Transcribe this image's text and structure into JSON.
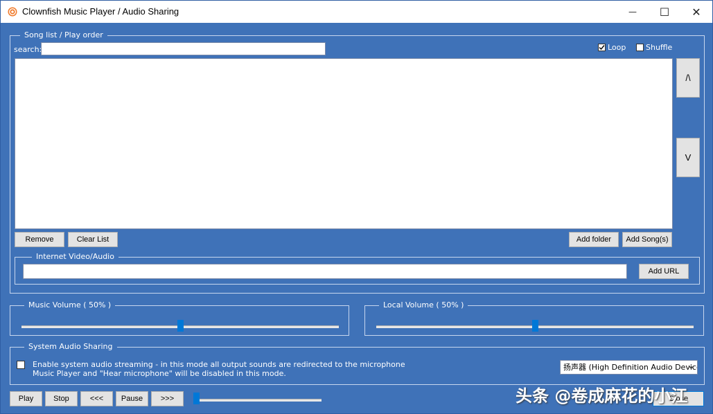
{
  "window": {
    "title": "Clownfish Music Player / Audio Sharing",
    "minimize_glyph": "—",
    "maximize_glyph": "☐",
    "close_glyph": "✕"
  },
  "song_group": {
    "legend": "Song list / Play order",
    "search_label": "search:",
    "search_value": "",
    "loop_label": "Loop",
    "loop_checked": true,
    "shuffle_label": "Shuffle",
    "shuffle_checked": false,
    "up_label": "/\\",
    "down_label": "V",
    "remove_label": "Remove",
    "clear_label": "Clear List",
    "add_folder_label": "Add folder",
    "add_songs_label": "Add Song(s)"
  },
  "internet_group": {
    "legend": "Internet Video/Audio",
    "url_value": "",
    "add_url_label": "Add URL"
  },
  "music_volume": {
    "legend": "Music Volume ( 50% )",
    "level": 0.5
  },
  "local_volume": {
    "legend": "Local Volume ( 50% )",
    "level": 0.5
  },
  "sharing_group": {
    "legend": "System Audio Sharing",
    "enable_checked": false,
    "line1": "Enable system audio streaming - in this mode all output sounds are redirected to the microphone",
    "line2": "Music Player and \"Hear microphone\" will be disabled  in this mode.",
    "device_selected": "扬声器 (High Definition Audio Device"
  },
  "transport": {
    "play": "Play",
    "stop": "Stop",
    "prev": "<<<",
    "pause": "Pause",
    "next": ">>>",
    "position": 0.0,
    "close": "Close"
  },
  "watermark": "头条 @卷成麻花的小江",
  "colors": {
    "window_bg": "#3f72b8",
    "accent": "#0078d7"
  }
}
